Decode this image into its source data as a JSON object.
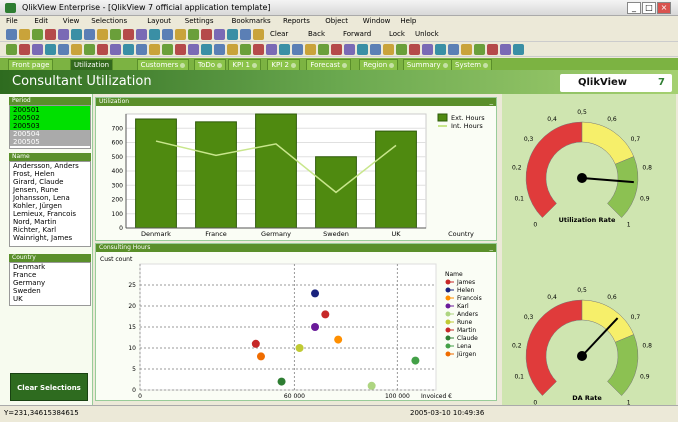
{
  "window": {
    "title": "QlikView Enterprise - [QlikView 7 official application template]",
    "min": "_",
    "max": "□",
    "close": "×"
  },
  "menu": [
    "File",
    "Edit",
    "View",
    "Selections",
    "Layout",
    "Settings",
    "Bookmarks",
    "Reports",
    "Object",
    "Window",
    "Help"
  ],
  "toolbar": {
    "clear": "Clear",
    "back": "Back",
    "forward": "Forward",
    "lock": "Lock",
    "unlock": "Unlock"
  },
  "tabs": [
    {
      "label": "Front page",
      "active": false
    },
    {
      "label": "Utilization",
      "active": true
    },
    {
      "label": "Customers",
      "active": false
    },
    {
      "label": "ToDo",
      "active": false
    },
    {
      "label": "KPI 1",
      "active": false
    },
    {
      "label": "KPI 2",
      "active": false
    },
    {
      "label": "Forecast",
      "active": false
    },
    {
      "label": "Region",
      "active": false
    },
    {
      "label": "Summary",
      "active": false
    },
    {
      "label": "System",
      "active": false
    }
  ],
  "header": {
    "title": "Consultant Utilization",
    "logo_text": "QlikView",
    "logo_ver": "7"
  },
  "period": {
    "title": "Period",
    "items": [
      {
        "label": "200501",
        "state": "selected"
      },
      {
        "label": "200502",
        "state": "selected"
      },
      {
        "label": "200503",
        "state": "selected"
      },
      {
        "label": "200504",
        "state": "excluded"
      },
      {
        "label": "200505",
        "state": "excluded"
      }
    ]
  },
  "names": {
    "title": "Name",
    "items": [
      "Andersson, Anders",
      "Frost, Helen",
      "Girard, Claude",
      "Jensen, Rune",
      "Johansson, Lena",
      "Kohler, Jürgen",
      "Lemieux, Francois",
      "Nord, Martin",
      "Richter, Karl",
      "Wainright, James"
    ]
  },
  "country": {
    "title": "Country",
    "items": [
      "Denmark",
      "France",
      "Germany",
      "Sweden",
      "UK"
    ]
  },
  "clear_selections": "Clear Selections",
  "utilization": {
    "title": "Utilization",
    "min": "_"
  },
  "consulting": {
    "title": "Consulting Hours",
    "min": "_"
  },
  "chart_data": [
    {
      "type": "bar",
      "title": "Utilization",
      "xlabel": "Country",
      "ylabel": "",
      "categories": [
        "Denmark",
        "France",
        "Germany",
        "Sweden",
        "UK"
      ],
      "ylim": [
        0,
        800
      ],
      "yticks": [
        0,
        100,
        200,
        300,
        400,
        500,
        600,
        700
      ],
      "series": [
        {
          "name": "Ext. Hours",
          "kind": "bar",
          "color": "#4f8a10",
          "values": [
            765,
            745,
            800,
            500,
            680
          ]
        },
        {
          "name": "Int. Hours",
          "kind": "line",
          "color": "#c8e68c",
          "values": [
            610,
            510,
            590,
            250,
            580
          ]
        }
      ]
    },
    {
      "type": "scatter",
      "title": "Consulting Hours",
      "xlabel": "Invoiced €",
      "ylabel": "Cust count",
      "xlim": [
        0,
        115000
      ],
      "ylim": [
        0,
        30
      ],
      "xticks": [
        0,
        60000,
        100000
      ],
      "xticklabels": [
        "0",
        "60 000",
        "100 000"
      ],
      "yticks": [
        0,
        5,
        10,
        15,
        20,
        25
      ],
      "legend_title": "Name",
      "series": [
        {
          "name": "James",
          "color": "#c62828",
          "x": 72000,
          "y": 18
        },
        {
          "name": "Helen",
          "color": "#1a237e",
          "x": 68000,
          "y": 23
        },
        {
          "name": "Francois",
          "color": "#ff8f00",
          "x": 77000,
          "y": 12
        },
        {
          "name": "Karl",
          "color": "#6a1b9a",
          "x": 68000,
          "y": 15
        },
        {
          "name": "Anders",
          "color": "#aed581",
          "x": 90000,
          "y": 1
        },
        {
          "name": "Rune",
          "color": "#c0ca33",
          "x": 62000,
          "y": 10
        },
        {
          "name": "Martin",
          "color": "#c62828",
          "x": 45000,
          "y": 11
        },
        {
          "name": "Claude",
          "color": "#2e7d32",
          "x": 55000,
          "y": 2
        },
        {
          "name": "Lena",
          "color": "#43a047",
          "x": 107000,
          "y": 7
        },
        {
          "name": "Jürgen",
          "color": "#ef6c00",
          "x": 47000,
          "y": 8
        }
      ]
    }
  ],
  "gauges": [
    {
      "label": "Utilization Rate",
      "value": 0.85,
      "ticks": [
        "0",
        "0,1",
        "0,2",
        "0,3",
        "0,4",
        "0,5",
        "0,6",
        "0,7",
        "0,8",
        "0,9",
        "1"
      ]
    },
    {
      "label": "DA Rate",
      "value": 0.66,
      "ticks": [
        "0",
        "0,1",
        "0,2",
        "0,3",
        "0,4",
        "0,5",
        "0,6",
        "0,7",
        "0,8",
        "0,9",
        "1"
      ]
    }
  ],
  "status": {
    "coords": "Y=231,34615384615",
    "datetime": "2005-03-10 10:49:36"
  }
}
